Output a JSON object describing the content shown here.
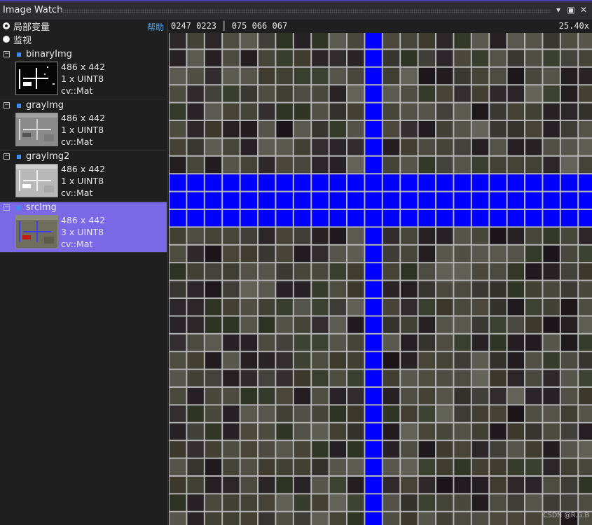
{
  "window": {
    "title": "Image Watch",
    "controls": [
      "▾",
      "▣",
      "✕"
    ]
  },
  "view_mode": {
    "locals_label": "局部变量",
    "watch_label": "监视",
    "selected": "locals",
    "help_label": "帮助"
  },
  "variables": [
    {
      "name": "binaryImg",
      "size": "486 x 442",
      "type": "1 x UINT8",
      "class": "cv::Mat",
      "selected": false
    },
    {
      "name": "grayImg",
      "size": "486 x 442",
      "type": "1 x UINT8",
      "class": "cv::Mat",
      "selected": false
    },
    {
      "name": "grayImg2",
      "size": "486 x 442",
      "type": "1 x UINT8",
      "class": "cv::Mat",
      "selected": false
    },
    {
      "name": "srcImg",
      "size": "486 x 442",
      "type": "3 x UINT8",
      "class": "cv::Mat",
      "selected": true
    }
  ],
  "viewer": {
    "pixel_info": "0247 0223 │ 075 066 067",
    "zoom": "25.40x",
    "highlight_color": "#0000ff",
    "grid_color": "#b4b4b4"
  },
  "watermark": "CSDN @R.G.B",
  "icons": {
    "collapse": "collapse-box-icon",
    "type": "matrix-type-icon"
  }
}
